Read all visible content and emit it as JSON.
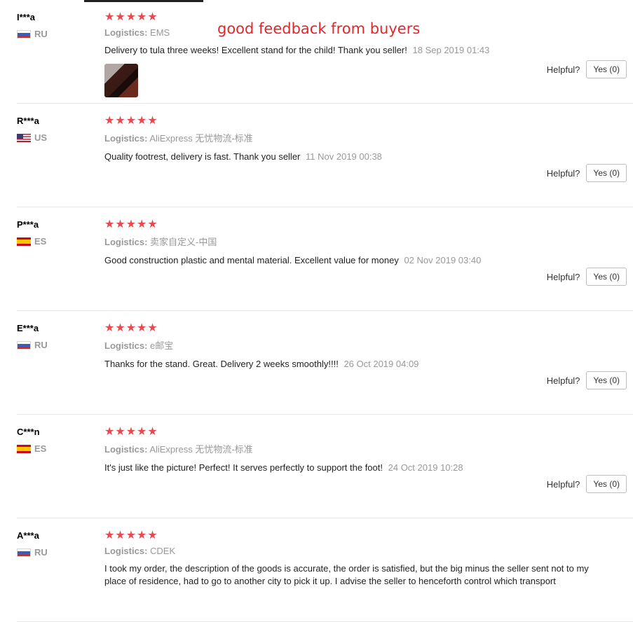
{
  "overlay_title": "good feedback from buyers",
  "colors": {
    "stars": "#e8494f",
    "overlay_title": "#e4262b"
  },
  "reviews": [
    {
      "user": "I***a",
      "country": "RU",
      "flag": "flag-ru",
      "stars": "★★★★★",
      "logistics_label": "Logistics:",
      "logistics": "EMS",
      "text": "Delivery to tula three weeks! Excellent stand for the child! Thank you seller!",
      "date": "18 Sep 2019 01:43",
      "helpful_label": "Helpful?",
      "yes_label": "Yes (0)"
    },
    {
      "user": "R***a",
      "country": "US",
      "flag": "flag-us",
      "stars": "★★★★★",
      "logistics_label": "Logistics:",
      "logistics": "AliExpress 无忧物流-标准",
      "text": "Quality footrest, delivery is fast. Thank you seller",
      "date": "11 Nov 2019 00:38",
      "helpful_label": "Helpful?",
      "yes_label": "Yes (0)"
    },
    {
      "user": "P***a",
      "country": "ES",
      "flag": "flag-es",
      "stars": "★★★★★",
      "logistics_label": "Logistics:",
      "logistics": "卖家自定义-中国",
      "text": "Good construction plastic and mental material. Excellent value for money",
      "date": "02 Nov 2019 03:40",
      "helpful_label": "Helpful?",
      "yes_label": "Yes (0)"
    },
    {
      "user": "E***a",
      "country": "RU",
      "flag": "flag-ru",
      "stars": "★★★★★",
      "logistics_label": "Logistics:",
      "logistics": "e邮宝",
      "text": "Thanks for the stand. Great. Delivery 2 weeks smoothly!!!!",
      "date": "26 Oct 2019 04:09",
      "helpful_label": "Helpful?",
      "yes_label": "Yes (0)"
    },
    {
      "user": "C***n",
      "country": "ES",
      "flag": "flag-es",
      "stars": "★★★★★",
      "logistics_label": "Logistics:",
      "logistics": "AliExpress 无忧物流-标准",
      "text": "It's just like the picture! Perfect! It serves perfectly to support the foot!",
      "date": "24 Oct 2019 10:28",
      "helpful_label": "Helpful?",
      "yes_label": "Yes (0)"
    },
    {
      "user": "A***a",
      "country": "RU",
      "flag": "flag-ru",
      "stars": "★★★★★",
      "logistics_label": "Logistics:",
      "logistics": "CDEK",
      "text": "I took my order, the description of the goods is accurate, the order is satisfied, but the big minus the seller sent not to my place of residence, had to go to another city to pick it up. I advise the seller to henceforth control which transport"
    }
  ]
}
